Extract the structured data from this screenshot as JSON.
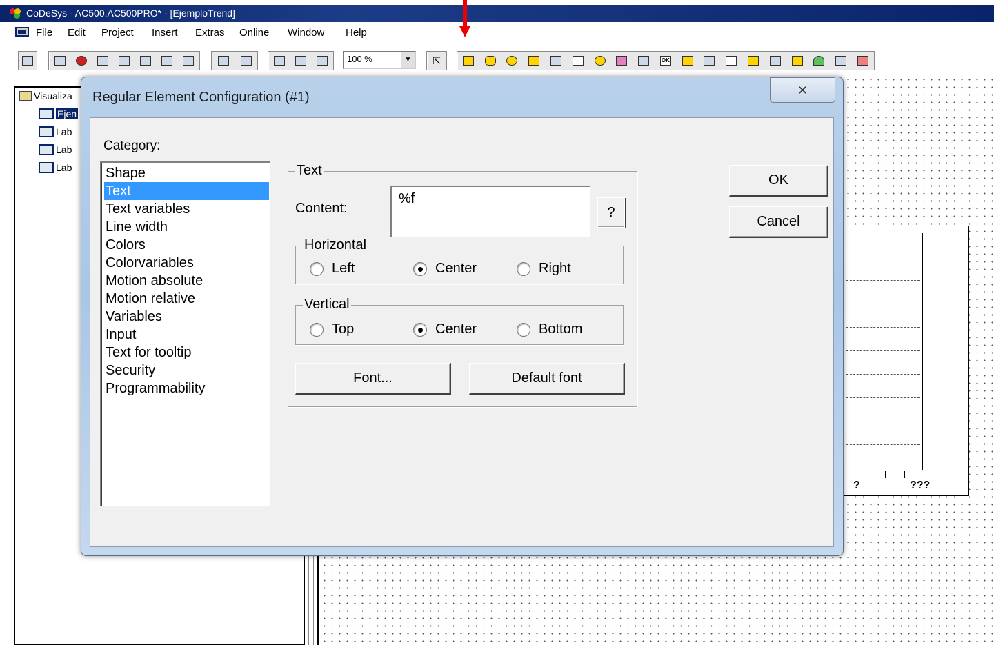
{
  "window": {
    "title": "CoDeSys - AC500.AC500PRO* - [EjemploTrend]"
  },
  "menubar": {
    "items": [
      "File",
      "Edit",
      "Project",
      "Insert",
      "Extras",
      "Online",
      "Window",
      "Help"
    ]
  },
  "toolbar": {
    "zoom": "100 %",
    "buttons": [
      "save-icon",
      "load-icon",
      "stop-icon",
      "run-icon",
      "step-icon",
      "print-icon",
      "download-icon",
      "monitor-icon",
      "cut-icon",
      "copy-icon",
      "cut2-icon",
      "copy2-icon",
      "paste-icon",
      "select-icon",
      "rectangle-icon",
      "rounded-rect-icon",
      "ellipse-icon",
      "polygon-icon",
      "polyline-icon",
      "curve-icon",
      "pie-icon",
      "bitmap-icon",
      "visualization-icon",
      "button-icon",
      "wmf-icon",
      "table-icon",
      "trend-icon",
      "alarm-table-icon",
      "activex-icon",
      "scrollbar-icon",
      "meter-icon",
      "bar-display-icon",
      "histogram-icon"
    ]
  },
  "tree": {
    "root": "Visualiza",
    "items": [
      "Ejen",
      "Lab",
      "Lab",
      "Lab"
    ]
  },
  "trend": {
    "labels": [
      "?",
      "???"
    ]
  },
  "dialog": {
    "title": "Regular Element Configuration (#1)",
    "close_label": "✕",
    "category_label": "Category:",
    "categories": [
      "Shape",
      "Text",
      "Text variables",
      "Line width",
      "Colors",
      "Colorvariables",
      "Motion absolute",
      "Motion relative",
      "Variables",
      "Input",
      "Text for tooltip",
      "Security",
      "Programmability"
    ],
    "selected_category": "Text",
    "text_group": {
      "title": "Text",
      "content_label": "Content:",
      "content_value": "%f",
      "help_label": "?",
      "horizontal": {
        "title": "Horizontal",
        "options": [
          "Left",
          "Center",
          "Right"
        ],
        "selected": "Center"
      },
      "vertical": {
        "title": "Vertical",
        "options": [
          "Top",
          "Center",
          "Bottom"
        ],
        "selected": "Center"
      },
      "font_button": "Font...",
      "default_font_button": "Default font"
    },
    "ok_label": "OK",
    "cancel_label": "Cancel"
  },
  "colors": {
    "selection": "#3399ff",
    "titlebar": "#0a246a",
    "arrow": "#e00000"
  }
}
